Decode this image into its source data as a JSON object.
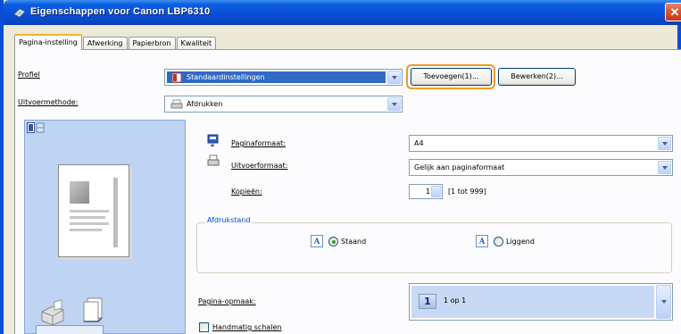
{
  "window": {
    "title": "Eigenschappen voor Canon LBP6310",
    "close_glyph": "✕"
  },
  "tabs": [
    {
      "label": "Pagina-instelling",
      "active": true
    },
    {
      "label": "Afwerking",
      "active": false
    },
    {
      "label": "Papierbron",
      "active": false
    },
    {
      "label": "Kwaliteit",
      "active": false
    }
  ],
  "profile": {
    "label": "Profiel",
    "value": "Standaardinstellingen",
    "add_button": "Toevoegen(1)...",
    "edit_button": "Bewerken(2)..."
  },
  "output_method": {
    "label": "Uitvoermethode:",
    "value": "Afdrukken"
  },
  "page_size": {
    "label": "Paginaformaat:",
    "value": "A4"
  },
  "output_size": {
    "label": "Uitvoerformaat:",
    "value": "Gelijk aan paginaformaat"
  },
  "copies": {
    "label": "Kopieën:",
    "value": "1",
    "range": "[1 tot 999]"
  },
  "orientation": {
    "title": "Afdrukstand",
    "portrait_label": "Staand",
    "landscape_label": "Liggend",
    "icon_glyph": "A",
    "selected": "portrait"
  },
  "page_layout": {
    "label": "Pagina-opmaak:",
    "icon_number": "1",
    "value": "1 op 1"
  },
  "manual_scaling": {
    "label": "Handmatig schalen",
    "checked": false
  },
  "colors": {
    "titlebar": "#0a4ed8",
    "highlight_ring": "#f39a1e",
    "selection": "#316ac5"
  }
}
